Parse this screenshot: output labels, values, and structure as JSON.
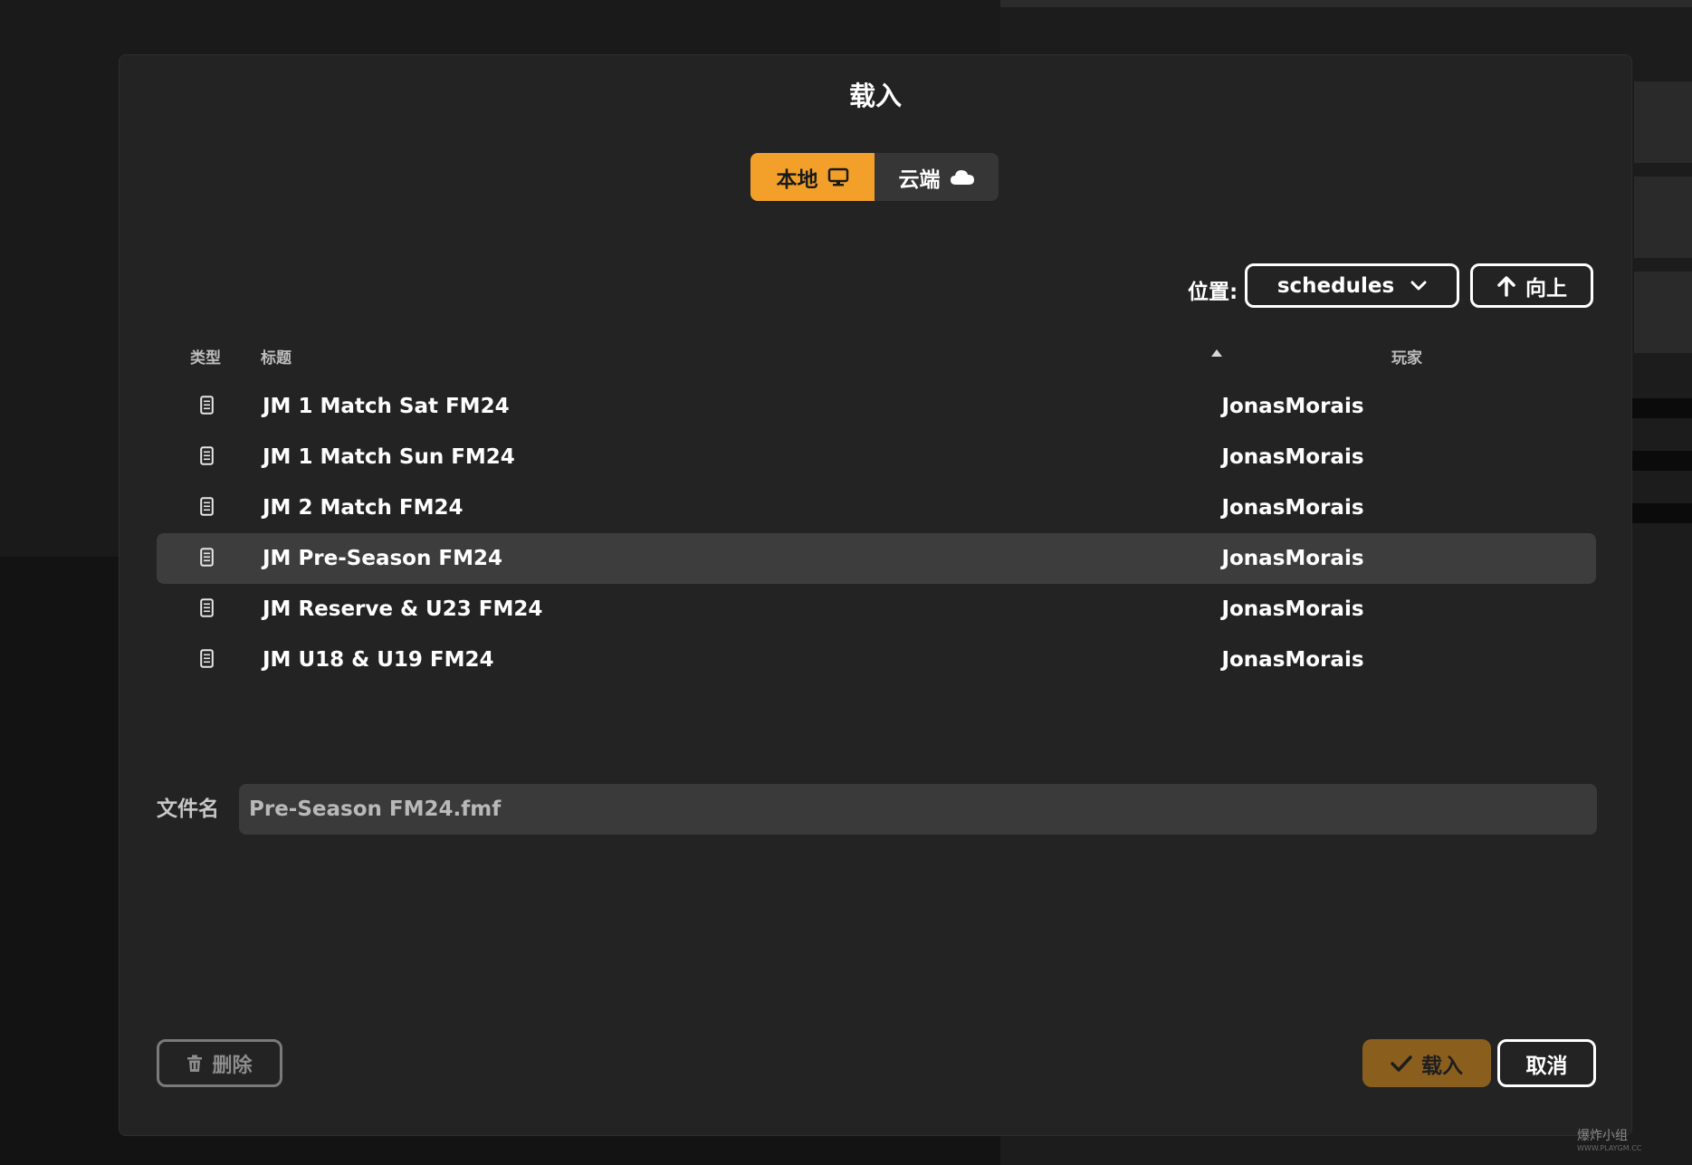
{
  "dialog": {
    "title": "载入",
    "tabs": [
      {
        "label": "本地",
        "icon": "monitor-icon",
        "active": true
      },
      {
        "label": "云端",
        "icon": "cloud-icon",
        "active": false
      }
    ],
    "location": {
      "label": "位置:",
      "selected": "schedules",
      "up_label": "向上"
    },
    "columns": {
      "type": "类型",
      "title": "标题",
      "player": "玩家"
    },
    "files": [
      {
        "title": "JM 1 Match Sat FM24",
        "player": "JonasMorais",
        "selected": false
      },
      {
        "title": "JM 1 Match Sun FM24",
        "player": "JonasMorais",
        "selected": false
      },
      {
        "title": "JM 2 Match FM24",
        "player": "JonasMorais",
        "selected": false
      },
      {
        "title": "JM Pre-Season FM24",
        "player": "JonasMorais",
        "selected": true
      },
      {
        "title": "JM Reserve & U23 FM24",
        "player": "JonasMorais",
        "selected": false
      },
      {
        "title": "JM U18 & U19 FM24",
        "player": "JonasMorais",
        "selected": false
      }
    ],
    "filename": {
      "label": "文件名",
      "value": "Pre-Season FM24.fmf"
    },
    "buttons": {
      "delete": "删除",
      "load": "载入",
      "cancel": "取消"
    }
  },
  "watermark": {
    "text": "爆炸小组",
    "url": "WWW.PLAYGM.CC"
  },
  "colors": {
    "accent": "#f3a02a",
    "modal_bg": "#232323",
    "selected_row": "#3d3d3d"
  }
}
